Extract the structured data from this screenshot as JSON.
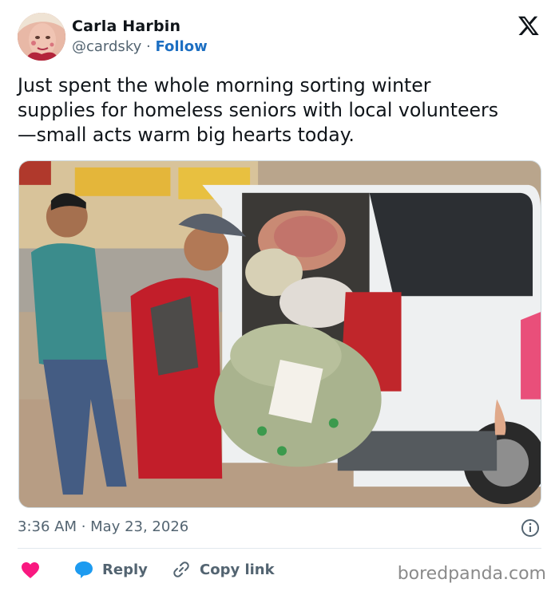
{
  "author": {
    "name": "Carla Harbin",
    "handle": "@cardsky",
    "separator": "·",
    "follow_label": "Follow"
  },
  "tweet": {
    "text": "Just spent the whole morning sorting winter supplies for homeless seniors with local volunteers—small acts warm big hearts today.",
    "line1": "Just spent the whole morning sorting winter",
    "line2": "supplies for homeless seniors with local volunteers",
    "line3": "—small acts warm big hearts today.",
    "timestamp": "3:36 AM · May 23, 2026"
  },
  "actions": {
    "reply_label": "Reply",
    "copy_label": "Copy link"
  },
  "watermark": "boredpanda.com",
  "icons": {
    "logo": "x-logo-icon",
    "info": "info-icon",
    "like": "heart-icon",
    "reply": "reply-bubble-icon",
    "copy": "link-icon"
  },
  "colors": {
    "follow": "#1d6fc2",
    "heart": "#f91880",
    "reply": "#1d9bf0",
    "muted": "#536471"
  }
}
